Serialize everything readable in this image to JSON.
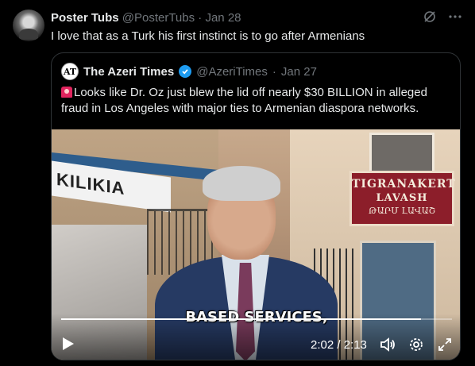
{
  "tweet": {
    "author_name": "Poster Tubs",
    "author_handle": "@PosterTubs",
    "separator": "·",
    "date": "Jan 28",
    "text": "I love that as a Turk his first instinct is to go after Armenians"
  },
  "quote": {
    "author_name": "The Azeri Times",
    "author_handle": "@AzeriTimes",
    "separator": "·",
    "date": "Jan 27",
    "avatar_text": "AT",
    "text": "Looks like Dr. Oz just blew the lid off nearly $30 BILLION in alleged fraud in Los Angeles with major ties to Armenian diaspora networks."
  },
  "video": {
    "caption": "BASED SERVICES,",
    "time": "2:02 / 2:13",
    "progress_fraction": 0.92,
    "sign_line1": "TIGRANAKERT",
    "sign_line2": "LAVASH",
    "sign_line3": "ԹԱՐՄ ԼԱՎԱՇ",
    "banner_text": "KILIKIA"
  },
  "colors": {
    "accent": "#1d9bf0",
    "muted": "#71767b",
    "border": "#2f3336"
  }
}
